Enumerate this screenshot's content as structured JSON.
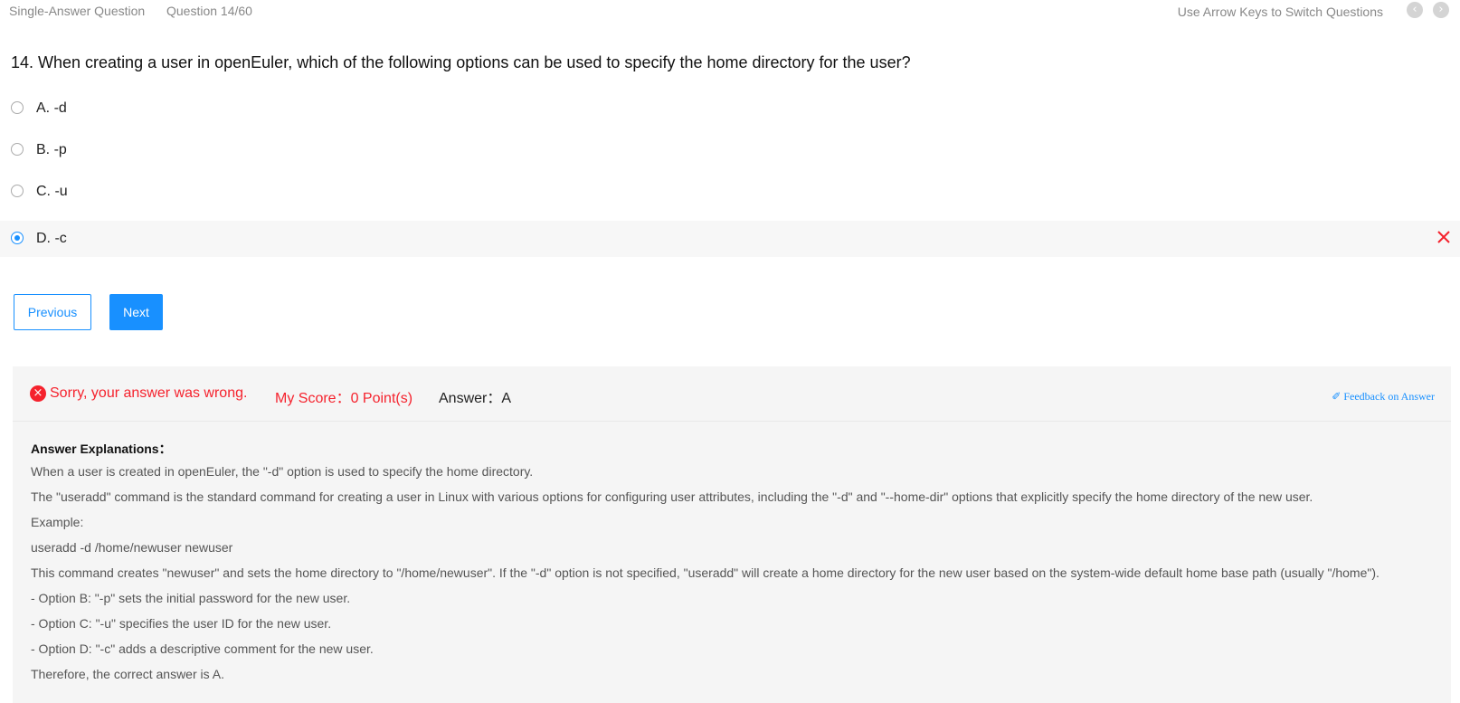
{
  "header": {
    "question_type": "Single-Answer Question",
    "question_counter": "Question 14/60",
    "hint": "Use Arrow Keys to Switch Questions",
    "prev_icon": "‹",
    "next_icon": "›"
  },
  "question": {
    "text": "14. When creating a user in openEuler, which of the following options can be used to specify the home directory for the user?",
    "options": [
      {
        "label": "A. -d",
        "selected": false
      },
      {
        "label": "B. -p",
        "selected": false
      },
      {
        "label": "C. -u",
        "selected": false
      },
      {
        "label": "D. -c",
        "selected": true,
        "marked_wrong": true
      }
    ]
  },
  "buttons": {
    "previous": "Previous",
    "next": "Next"
  },
  "result": {
    "status": "Sorry, your answer was wrong.",
    "score": "My Score：0 Point(s)",
    "answer": "Answer：A",
    "feedback": "✐ Feedback on Answer",
    "error_icon": "×"
  },
  "explanation": {
    "title": "Answer Explanations：",
    "lines": [
      "When a user is created in openEuler, the \"-d\" option is used to specify the home directory.",
      "The \"useradd\" command is the standard command for creating a user in Linux with various options for configuring user attributes, including the \"-d\" and \"--home-dir\" options that explicitly specify the home directory of the new user.",
      "Example:",
      "useradd -d /home/newuser newuser",
      "This command creates \"newuser\" and sets the home directory to \"/home/newuser\". If the \"-d\" option is not specified, \"useradd\" will create a home directory for the new user based on the system-wide default home base path (usually \"/home\").",
      "- Option B: \"-p\" sets the initial password for the new user.",
      "- Option C: \"-u\" specifies the user ID for the new user.",
      "- Option D: \"-c\" adds a descriptive comment for the new user.",
      "Therefore, the correct answer is A."
    ]
  },
  "colors": {
    "accent": "#1890ff",
    "error": "#f5222d",
    "panel_bg": "#f5f5f5"
  }
}
